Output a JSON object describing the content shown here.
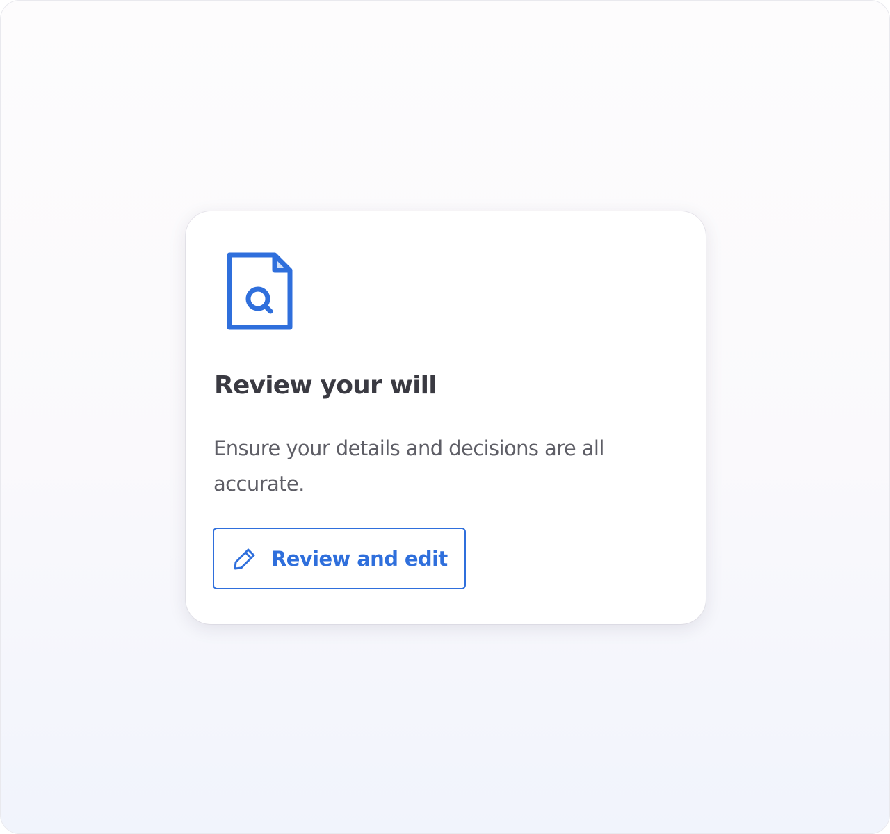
{
  "card": {
    "icon": "document-search-icon",
    "title": "Review your will",
    "description": "Ensure your details and decisions are all accurate.",
    "button": {
      "icon": "pencil-icon",
      "label": "Review and edit"
    }
  },
  "colors": {
    "accent": "#2f6fdc",
    "title": "#3a3a42",
    "body_text": "#5e5e66",
    "card_background": "#ffffff",
    "page_background": "#faf9fc"
  }
}
